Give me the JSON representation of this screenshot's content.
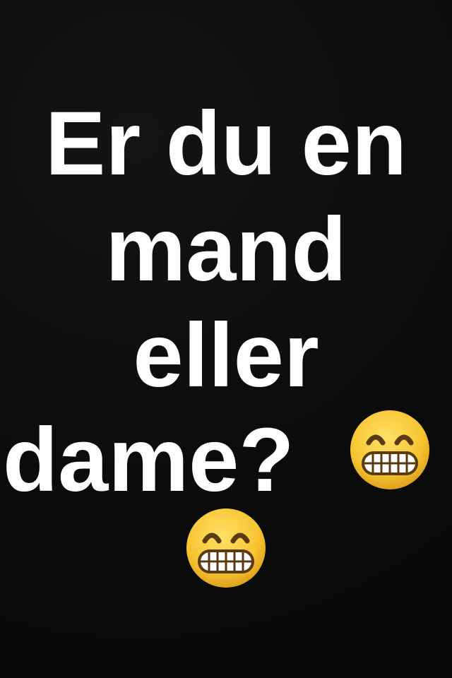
{
  "text": {
    "line1": "Er du en",
    "line2": "mand",
    "line3": "eller",
    "line4": "dame?"
  },
  "icons": {
    "emoji1": "grimacing-face-emoji",
    "emoji2": "grimacing-face-emoji"
  },
  "colors": {
    "background": "#0a0a0a",
    "text": "#ffffff",
    "emoji_face": "#f7c531"
  }
}
